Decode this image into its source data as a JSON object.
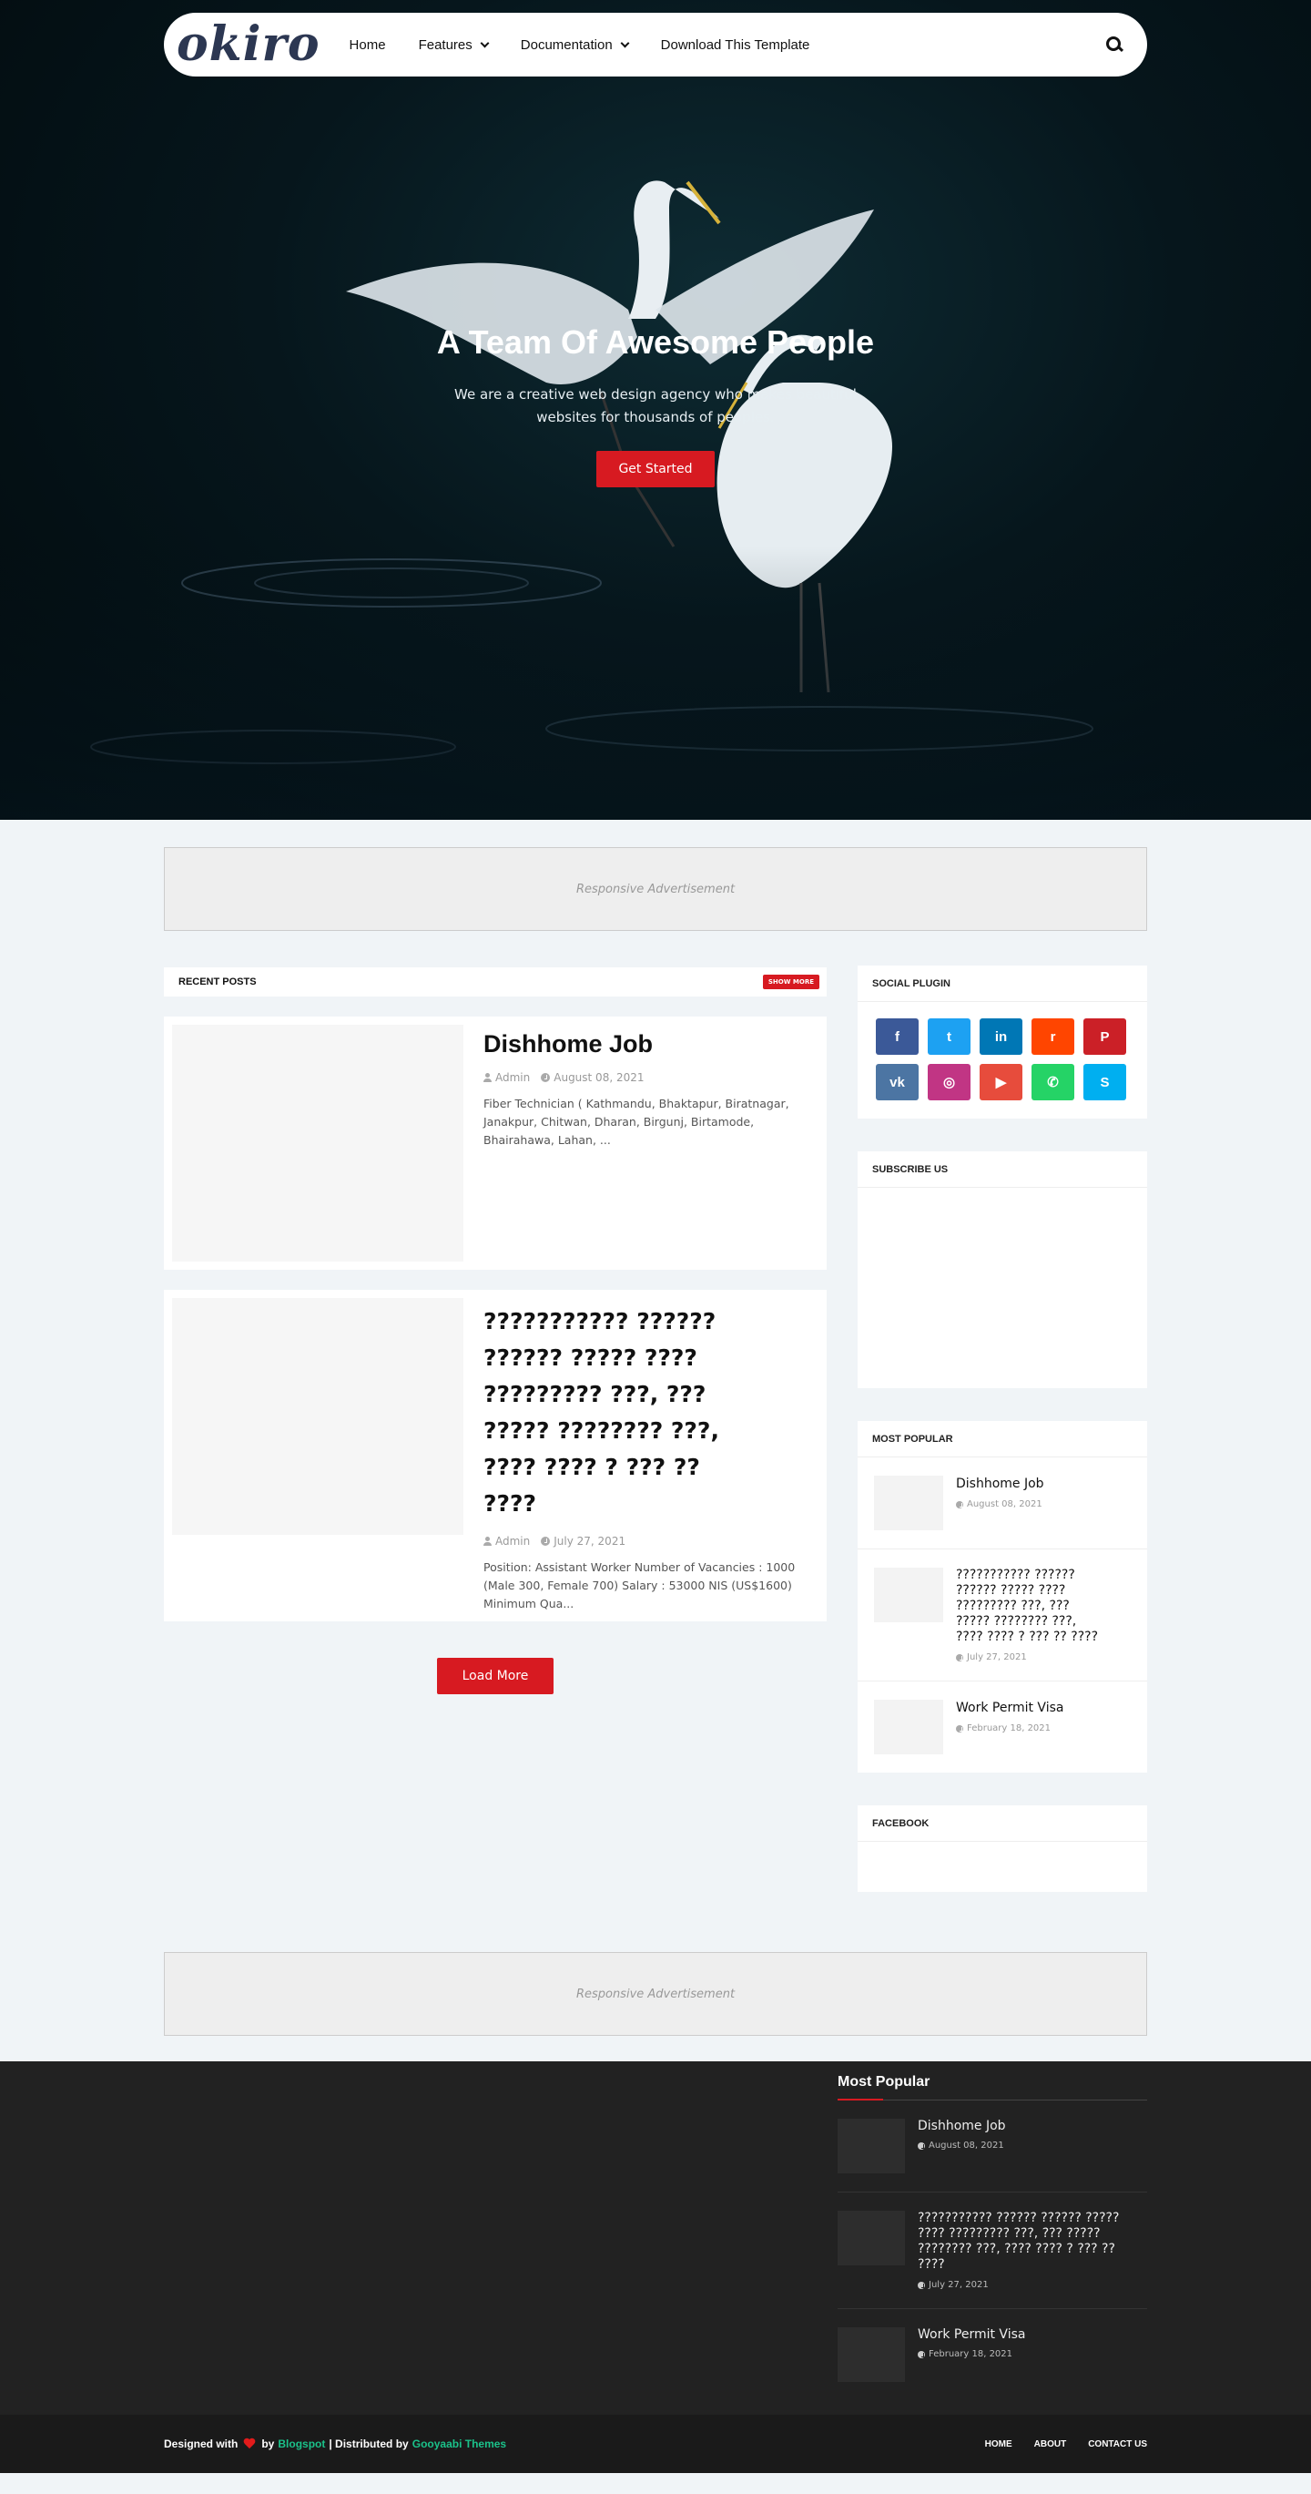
{
  "header": {
    "logo": "okiro",
    "nav": [
      {
        "label": "Home"
      },
      {
        "label": "Features"
      },
      {
        "label": "Documentation"
      },
      {
        "label": "Download This Template"
      }
    ]
  },
  "hero": {
    "title": "A Team Of Awesome People",
    "subtitle": "We are a creative web design agency who makes beautiful websites for thousands of peoples.",
    "button": "Get Started"
  },
  "ads": {
    "label": "Responsive Advertisement"
  },
  "recent_posts": {
    "heading": "RECENT POSTS",
    "show_more": "SHOW MORE",
    "posts": [
      {
        "title": "Dishhome Job",
        "author": "Admin",
        "date": "August 08, 2021",
        "excerpt": "Fiber Technician ( Kathmandu, Bhaktapur, Biratnagar, Janakpur, Chitwan, Dharan, Birgunj, Birtamode, Bhairahawa, Lahan, ..."
      },
      {
        "title": "??????????? ?????? ?????? ????? ???? ????????? ???, ??? ????? ???????? ???, ???? ???? ? ??? ?? ????",
        "author": "Admin",
        "date": "July 27, 2021",
        "excerpt": "Position: Assistant Worker Number of Vacancies : 1000 (Male 300, Female 700) Salary : 53000 NIS (US$1600) Minimum Qua..."
      }
    ],
    "load_more": "Load More"
  },
  "sidebar": {
    "social": {
      "heading": "SOCIAL PLUGIN",
      "icons": [
        {
          "name": "facebook-icon",
          "glyph": "f",
          "color": "#3b5998"
        },
        {
          "name": "twitter-icon",
          "glyph": "t",
          "color": "#1da1f2"
        },
        {
          "name": "linkedin-icon",
          "glyph": "in",
          "color": "#0077b5"
        },
        {
          "name": "reddit-icon",
          "glyph": "r",
          "color": "#ff4500"
        },
        {
          "name": "pinterest-icon",
          "glyph": "P",
          "color": "#cb2027"
        },
        {
          "name": "vk-icon",
          "glyph": "vk",
          "color": "#4c75a3"
        },
        {
          "name": "instagram-icon",
          "glyph": "◎",
          "color": "#c13584"
        },
        {
          "name": "youtube-icon",
          "glyph": "▶",
          "color": "#e74c3c"
        },
        {
          "name": "whatsapp-icon",
          "glyph": "✆",
          "color": "#25d366"
        },
        {
          "name": "skype-icon",
          "glyph": "S",
          "color": "#00aff0"
        }
      ]
    },
    "subscribe": {
      "heading": "SUBSCRIBE US"
    },
    "most_popular": {
      "heading": "MOST POPULAR",
      "items": [
        {
          "title": "Dishhome Job",
          "date": "August 08, 2021"
        },
        {
          "title": "??????????? ?????? ?????? ????? ???? ????????? ???, ??? ????? ???????? ???, ???? ???? ? ??? ?? ????",
          "date": "July 27, 2021"
        },
        {
          "title": "Work Permit Visa",
          "date": "February 18, 2021"
        }
      ]
    },
    "facebook": {
      "heading": "FACEBOOK"
    }
  },
  "footer": {
    "heading": "Most Popular",
    "items": [
      {
        "title": "Dishhome Job",
        "date": "August 08, 2021"
      },
      {
        "title": "??????????? ?????? ?????? ????? ???? ????????? ???, ??? ????? ???????? ???, ???? ???? ? ??? ?? ????",
        "date": "July 27, 2021"
      },
      {
        "title": "Work Permit Visa",
        "date": "February 18, 2021"
      }
    ],
    "credit": {
      "designed_with": "Designed with",
      "by": "by",
      "blogspot": "Blogspot",
      "distributed": "| Distributed by",
      "themes": "Gooyaabi Themes"
    },
    "links": [
      "HOME",
      "ABOUT",
      "CONTACT US"
    ]
  },
  "colors": {
    "accent": "#d71a21",
    "footer_bg": "#222222",
    "credit_link": "#1ac28a"
  }
}
